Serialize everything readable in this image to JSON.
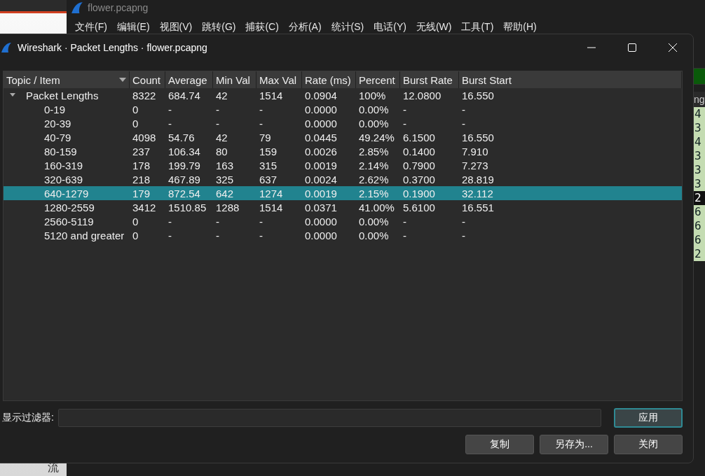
{
  "background_window": {
    "title": "flower.pcapng",
    "menu": [
      "文件(F)",
      "编辑(E)",
      "视图(V)",
      "跳转(G)",
      "捕获(C)",
      "分析(A)",
      "统计(S)",
      "电话(Y)",
      "无线(W)",
      "工具(T)",
      "帮助(H)"
    ],
    "packet_list": {
      "header": "ng",
      "rows": [
        {
          "text": "4",
          "selected": false
        },
        {
          "text": "3",
          "selected": false
        },
        {
          "text": "4",
          "selected": false
        },
        {
          "text": "3",
          "selected": false
        },
        {
          "text": "3",
          "selected": false
        },
        {
          "text": "3",
          "selected": false
        },
        {
          "text": "2",
          "selected": true
        },
        {
          "text": "6",
          "selected": false
        },
        {
          "text": "6",
          "selected": false
        },
        {
          "text": "6",
          "selected": false
        },
        {
          "text": "2",
          "selected": false
        }
      ]
    },
    "side_text": "流"
  },
  "dialog": {
    "title": "Wireshark · Packet Lengths · flower.pcapng",
    "table": {
      "columns": [
        "Topic / Item",
        "Count",
        "Average",
        "Min Val",
        "Max Val",
        "Rate (ms)",
        "Percent",
        "Burst Rate",
        "Burst Start"
      ],
      "rows": [
        {
          "cells": [
            "Packet Lengths",
            "8322",
            "684.74",
            "42",
            "1514",
            "0.0904",
            "100%",
            "12.0800",
            "16.550"
          ],
          "expanded": true,
          "selected": false,
          "children": [
            {
              "cells": [
                "0-19",
                "0",
                "-",
                "-",
                "-",
                "0.0000",
                "0.00%",
                "-",
                "-"
              ],
              "selected": false
            },
            {
              "cells": [
                "20-39",
                "0",
                "-",
                "-",
                "-",
                "0.0000",
                "0.00%",
                "-",
                "-"
              ],
              "selected": false
            },
            {
              "cells": [
                "40-79",
                "4098",
                "54.76",
                "42",
                "79",
                "0.0445",
                "49.24%",
                "6.1500",
                "16.550"
              ],
              "selected": false
            },
            {
              "cells": [
                "80-159",
                "237",
                "106.34",
                "80",
                "159",
                "0.0026",
                "2.85%",
                "0.1400",
                "7.910"
              ],
              "selected": false
            },
            {
              "cells": [
                "160-319",
                "178",
                "199.79",
                "163",
                "315",
                "0.0019",
                "2.14%",
                "0.7900",
                "7.273"
              ],
              "selected": false
            },
            {
              "cells": [
                "320-639",
                "218",
                "467.89",
                "325",
                "637",
                "0.0024",
                "2.62%",
                "0.3700",
                "28.819"
              ],
              "selected": false
            },
            {
              "cells": [
                "640-1279",
                "179",
                "872.54",
                "642",
                "1274",
                "0.0019",
                "2.15%",
                "0.1900",
                "32.112"
              ],
              "selected": true
            },
            {
              "cells": [
                "1280-2559",
                "3412",
                "1510.85",
                "1288",
                "1514",
                "0.0371",
                "41.00%",
                "5.6100",
                "16.551"
              ],
              "selected": false
            },
            {
              "cells": [
                "2560-5119",
                "0",
                "-",
                "-",
                "-",
                "0.0000",
                "0.00%",
                "-",
                "-"
              ],
              "selected": false
            },
            {
              "cells": [
                "5120 and greater",
                "0",
                "-",
                "-",
                "-",
                "0.0000",
                "0.00%",
                "-",
                "-"
              ],
              "selected": false
            }
          ]
        }
      ]
    },
    "filter": {
      "label": "显示过滤器:"
    },
    "buttons": [
      {
        "label": "应用",
        "default": true
      },
      {
        "label": "复制",
        "default": false
      },
      {
        "label": "另存为...",
        "default": false
      },
      {
        "label": "关闭",
        "default": false
      }
    ]
  }
}
